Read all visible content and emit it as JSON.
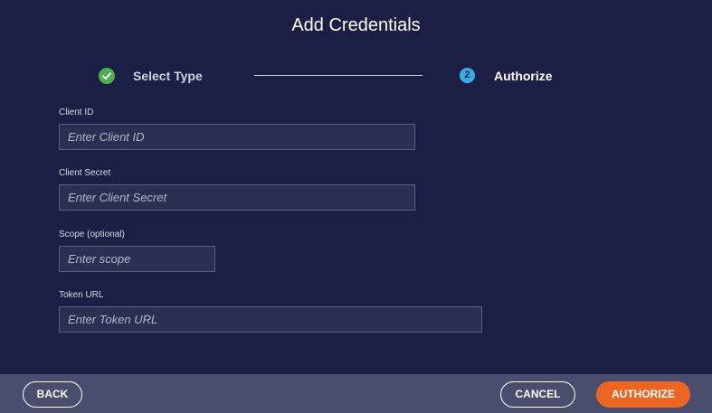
{
  "dialog": {
    "title": "Add Credentials"
  },
  "stepper": {
    "steps": [
      {
        "label": "Select Type",
        "status": "complete",
        "icon": "check-circle-icon"
      },
      {
        "label": "Authorize",
        "number": "2",
        "status": "active"
      }
    ]
  },
  "form": {
    "client_id": {
      "label": "Client ID",
      "placeholder": "Enter Client ID",
      "value": ""
    },
    "client_secret": {
      "label": "Client Secret",
      "placeholder": "Enter Client Secret",
      "value": ""
    },
    "scope": {
      "label": "Scope (optional)",
      "placeholder": "Enter scope",
      "value": ""
    },
    "token_url": {
      "label": "Token URL",
      "placeholder": "Enter Token URL",
      "value": ""
    }
  },
  "footer": {
    "back_label": "BACK",
    "cancel_label": "CANCEL",
    "authorize_label": "AUTHORIZE"
  },
  "colors": {
    "background": "#1b1f44",
    "footer": "#494d6e",
    "accent": "#ec6622",
    "step_active": "#35aee6",
    "step_complete": "#4caf50"
  }
}
